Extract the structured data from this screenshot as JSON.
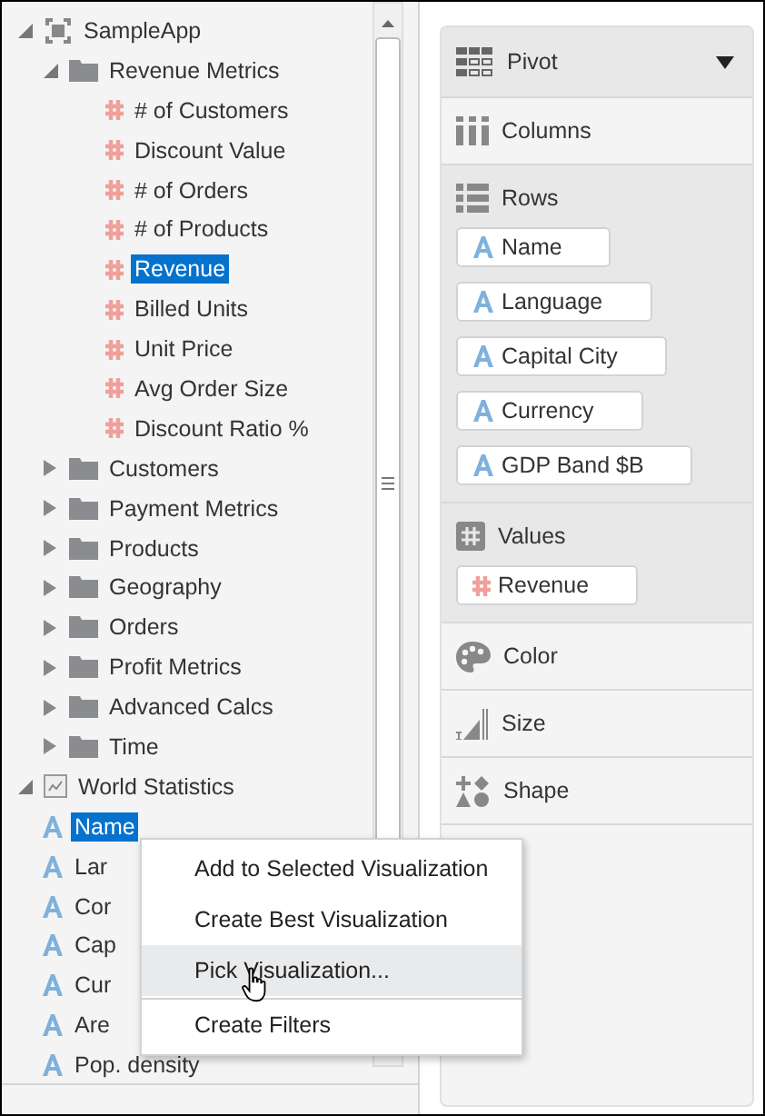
{
  "tree": [
    {
      "label": "SampleApp",
      "kind": "app",
      "expanded": true,
      "selected": false,
      "children": [
        {
          "label": "Revenue Metrics",
          "kind": "folder",
          "expanded": true,
          "selected": false,
          "children": [
            {
              "label": "# of Customers",
              "kind": "measure",
              "selected": false
            },
            {
              "label": "Discount Value",
              "kind": "measure",
              "selected": false
            },
            {
              "label": "# of Orders",
              "kind": "measure",
              "selected": false
            },
            {
              "label": "# of Products",
              "kind": "measure",
              "selected": false
            },
            {
              "label": "Revenue",
              "kind": "measure",
              "selected": true
            },
            {
              "label": "Billed Units",
              "kind": "measure",
              "selected": false
            },
            {
              "label": "Unit Price",
              "kind": "measure",
              "selected": false
            },
            {
              "label": "Avg Order Size",
              "kind": "measure",
              "selected": false
            },
            {
              "label": "Discount Ratio %",
              "kind": "measure",
              "selected": false
            }
          ]
        },
        {
          "label": "Customers",
          "kind": "folder",
          "expanded": false,
          "selected": false
        },
        {
          "label": "Payment Metrics",
          "kind": "folder",
          "expanded": false,
          "selected": false
        },
        {
          "label": "Products",
          "kind": "folder",
          "expanded": false,
          "selected": false
        },
        {
          "label": "Geography",
          "kind": "folder",
          "expanded": false,
          "selected": false
        },
        {
          "label": "Orders",
          "kind": "folder",
          "expanded": false,
          "selected": false
        },
        {
          "label": "Profit Metrics",
          "kind": "folder",
          "expanded": false,
          "selected": false
        },
        {
          "label": "Advanced Calcs",
          "kind": "folder",
          "expanded": false,
          "selected": false
        },
        {
          "label": "Time",
          "kind": "folder",
          "expanded": false,
          "selected": false
        }
      ]
    },
    {
      "label": "World Statistics",
      "kind": "dataset",
      "expanded": true,
      "selected": false,
      "children": [
        {
          "label": "Name",
          "kind": "attribute",
          "selected": true
        },
        {
          "label": "Lar",
          "kind": "attribute",
          "selected": false
        },
        {
          "label": "Cor",
          "kind": "attribute",
          "selected": false
        },
        {
          "label": "Cap",
          "kind": "attribute",
          "selected": false
        },
        {
          "label": "Cur",
          "kind": "attribute",
          "selected": false
        },
        {
          "label": "Are",
          "kind": "attribute",
          "selected": false
        },
        {
          "label": "Pop. density",
          "kind": "attribute",
          "selected": false
        }
      ]
    }
  ],
  "context_menu": [
    {
      "label": "Add to Selected Visualization",
      "selected": false,
      "separator_before": false
    },
    {
      "label": "Create Best Visualization",
      "selected": false,
      "separator_before": false
    },
    {
      "label": "Pick Visualization...",
      "selected": true,
      "separator_before": false
    },
    {
      "label": "Create Filters",
      "selected": false,
      "separator_before": true
    }
  ],
  "grammar_panel": {
    "visualization": "Pivot",
    "sections": [
      {
        "kind": "columns",
        "label": "Columns"
      },
      {
        "kind": "rows",
        "label": "Rows",
        "items": [
          {
            "label": "Name",
            "kind": "attribute"
          },
          {
            "label": "Language",
            "kind": "attribute"
          },
          {
            "label": "Capital City",
            "kind": "attribute"
          },
          {
            "label": "Currency",
            "kind": "attribute"
          },
          {
            "label": "GDP Band $B",
            "kind": "attribute"
          }
        ]
      },
      {
        "kind": "values",
        "label": "Values",
        "items": [
          {
            "label": "Revenue",
            "kind": "measure"
          }
        ]
      },
      {
        "kind": "color",
        "label": "Color"
      },
      {
        "kind": "size",
        "label": "Size"
      },
      {
        "kind": "shape",
        "label": "Shape"
      }
    ]
  }
}
